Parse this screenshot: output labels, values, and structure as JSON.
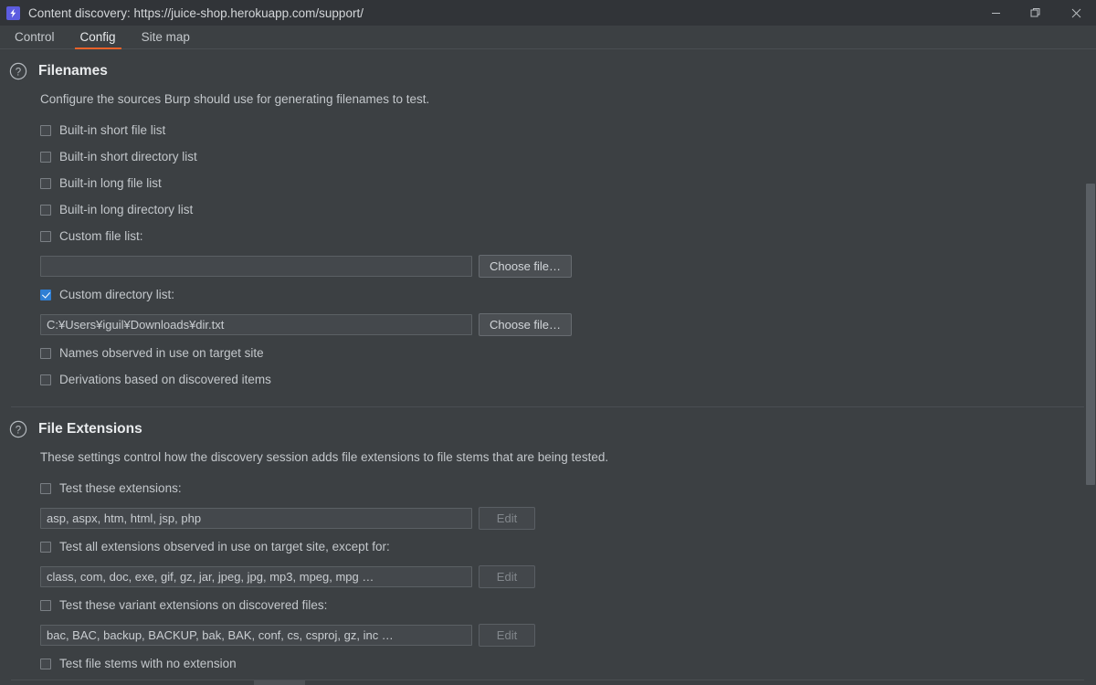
{
  "window": {
    "app_icon": "burp-lightning-icon",
    "title": "Content discovery: https://juice-shop.herokuapp.com/support/",
    "controls": {
      "minimize": "minimize-icon",
      "restore": "restore-icon",
      "close": "close-icon"
    }
  },
  "tabs": [
    {
      "label": "Control",
      "active": false
    },
    {
      "label": "Config",
      "active": true
    },
    {
      "label": "Site map",
      "active": false
    }
  ],
  "accent_color": "#e8622a",
  "checkbox_checked_color": "#2f7fd4",
  "sections": [
    {
      "id": "filenames",
      "help_icon": "question-circle-icon",
      "title": "Filenames",
      "description": "Configure the sources Burp should use for generating filenames to test.",
      "options": [
        {
          "label": "Built-in short file list",
          "checked": false
        },
        {
          "label": "Built-in short directory list",
          "checked": false
        },
        {
          "label": "Built-in long file list",
          "checked": false
        },
        {
          "label": "Built-in long directory list",
          "checked": false
        },
        {
          "label": "Custom file list:",
          "checked": false
        },
        {
          "label": "Custom directory list:",
          "checked": true
        },
        {
          "label": "Names observed in use on target site",
          "checked": false
        },
        {
          "label": "Derivations based on discovered items",
          "checked": false
        }
      ],
      "custom_file_list": {
        "value": "",
        "placeholder": "",
        "button_label": "Choose file…",
        "button_disabled": false
      },
      "custom_directory_list": {
        "value": "C:¥Users¥iguil¥Downloads¥dir.txt",
        "placeholder": "",
        "button_label": "Choose file…",
        "button_disabled": false
      }
    },
    {
      "id": "file-extensions",
      "help_icon": "question-circle-icon",
      "title": "File Extensions",
      "description": "These settings control how the discovery session adds file extensions to file stems that are being tested.",
      "options": [
        {
          "label": "Test these extensions:",
          "checked": false
        },
        {
          "label": "Test all extensions observed in use on target site, except for:",
          "checked": false
        },
        {
          "label": "Test these variant extensions on discovered files:",
          "checked": false
        },
        {
          "label": "Test file stems with no extension",
          "checked": false
        }
      ],
      "test_extensions": {
        "value": "asp, aspx, htm, html, jsp, php",
        "button_label": "Edit",
        "button_disabled": true
      },
      "except_extensions": {
        "value": "class, com, doc, exe, gif, gz, jar, jpeg, jpg, mp3, mpeg, mpg …",
        "button_label": "Edit",
        "button_disabled": true
      },
      "variant_extensions": {
        "value": "bac, BAC, backup, BACKUP, bak, BAK, conf, cs, csproj, gz, inc …",
        "button_label": "Edit",
        "button_disabled": true
      }
    }
  ]
}
